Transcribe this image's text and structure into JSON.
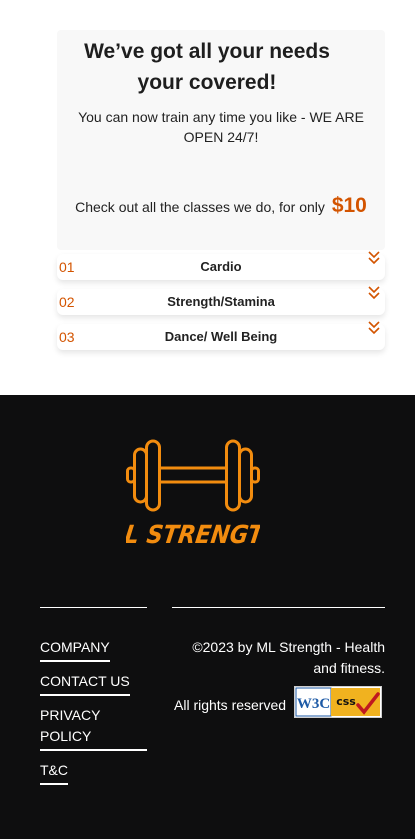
{
  "offer": {
    "headline": "We’ve got all your needs your covered!",
    "subline": "You can now train any time you like - WE ARE OPEN 24/7!",
    "price_text": "Check out all the classes we do, for only",
    "price": "$10"
  },
  "classes": [
    {
      "num": "01",
      "label": "Cardio"
    },
    {
      "num": "02",
      "label": "Strength/Stamina"
    },
    {
      "num": "03",
      "label": "Dance/ Well Being"
    }
  ],
  "footer": {
    "logo_text": "ML STRENGTH",
    "links": [
      "COMPANY",
      "CONTACT US",
      "PRIVACY POLICY",
      "T&C"
    ],
    "copyright": "©2023 by ML Strength - Health and fitness.",
    "rights": "All rights reserved",
    "badge": {
      "w3c": "W3C",
      "css": "css"
    }
  },
  "colors": {
    "accent": "#d35400",
    "logo_orange": "#f28c0f",
    "footer_bg": "#0e0e0f"
  }
}
